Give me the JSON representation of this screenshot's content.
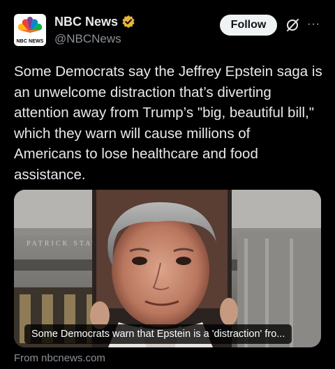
{
  "author": {
    "display_name": "NBC News",
    "handle": "@NBCNews",
    "logo_text": "NBC NEWS",
    "verified_badge_color": "#e8b33c"
  },
  "actions": {
    "follow_label": "Follow",
    "grok_icon": "grok-slash-circle-icon",
    "more_icon": "ellipsis-icon",
    "more_glyph": "···"
  },
  "post": {
    "text": "Some Democrats say the Jeffrey Epstein saga is\nan unwelcome distraction that’s diverting\nattention away from Trump’s \"big, beautiful bill,\"\nwhich they warn will cause millions of\nAmericans to lose healthcare and food\nassistance."
  },
  "link_card": {
    "caption": "Some Democrats warn that Epstein is a 'distraction' fro...",
    "building_inscription": "PATRICK  STATES",
    "source": "From nbcnews.com"
  },
  "colors": {
    "background": "#000000",
    "text_primary": "#e7e9ea",
    "text_secondary": "#8b9197",
    "follow_bg": "#eff3f4"
  }
}
